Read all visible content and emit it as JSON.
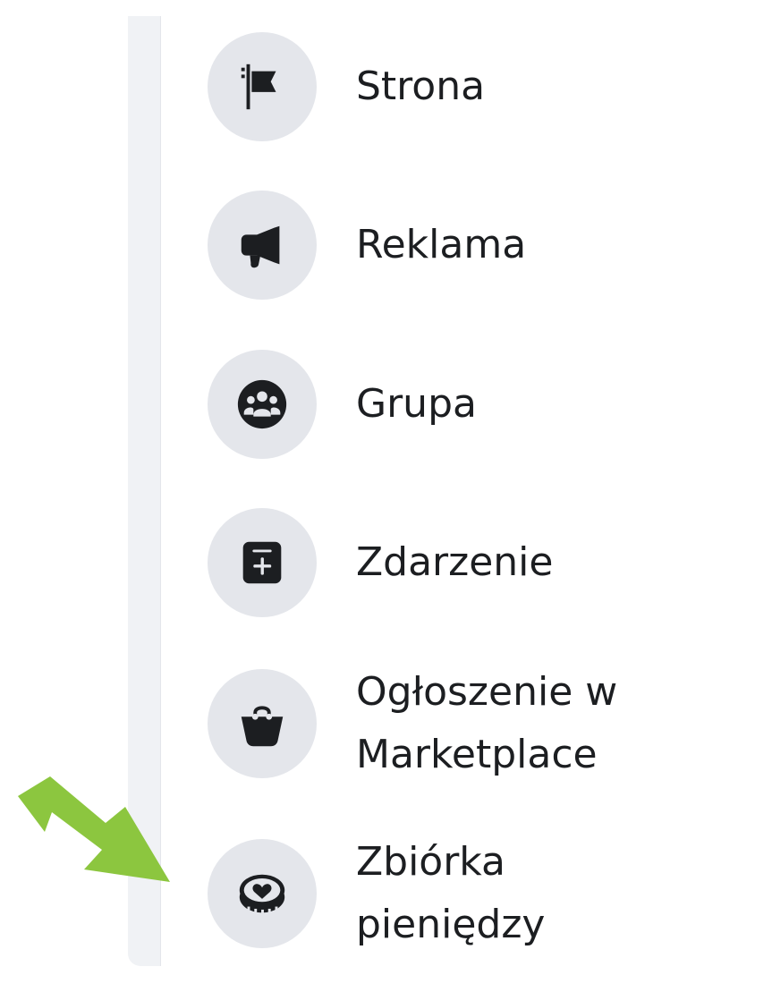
{
  "menu": {
    "items": [
      {
        "label": "Strona",
        "icon": "flag-icon"
      },
      {
        "label": "Reklama",
        "icon": "megaphone-icon"
      },
      {
        "label": "Grupa",
        "icon": "group-icon"
      },
      {
        "label": "Zdarzenie",
        "icon": "calendar-plus-icon"
      },
      {
        "label": "Ogłoszenie w\nMarketplace",
        "icon": "shopping-bag-icon"
      },
      {
        "label": "Zbiórka\npieniędzy",
        "icon": "heart-coin-icon"
      }
    ]
  },
  "colors": {
    "icon_bg": "#e4e6eb",
    "icon_fg": "#1c1e21",
    "text": "#1c1e21",
    "rail": "#f0f2f5",
    "arrow": "#8cc63f"
  }
}
